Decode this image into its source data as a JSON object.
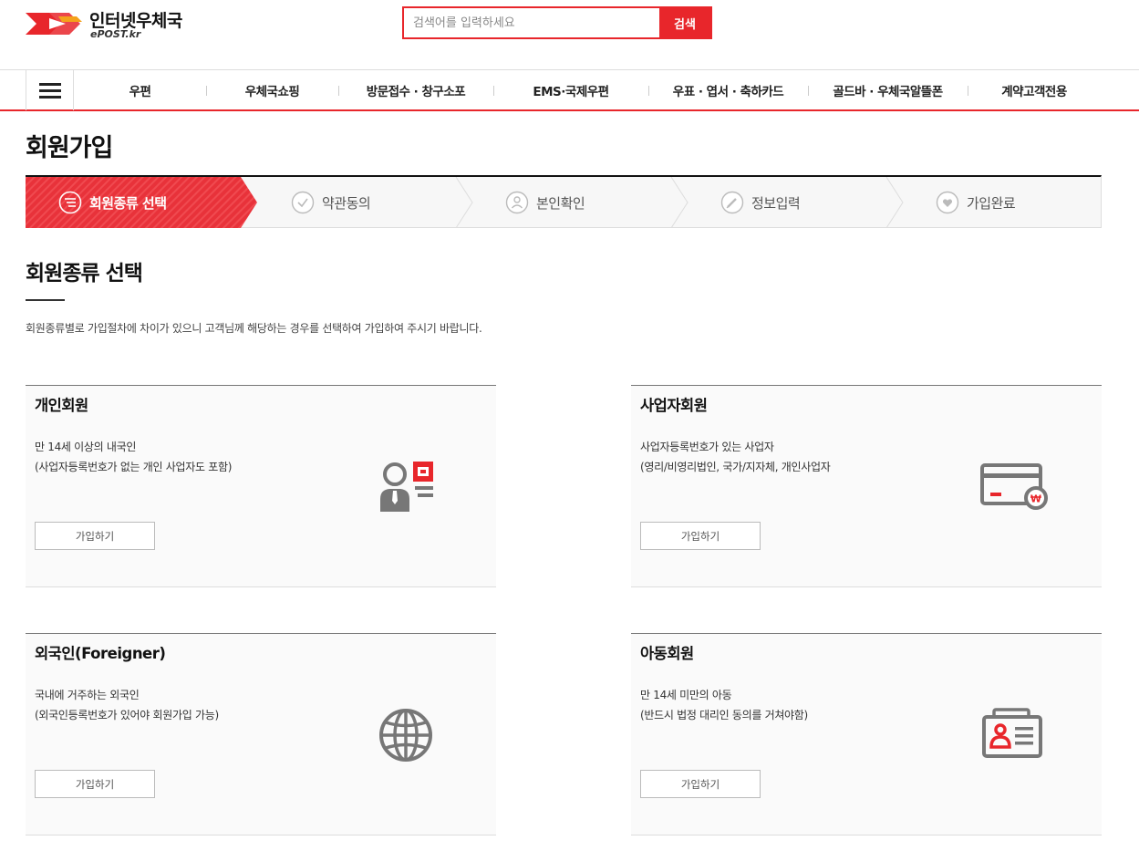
{
  "header": {
    "logo_title": "인터넷우체국",
    "logo_sub": "ePOST.kr",
    "search_placeholder": "검색어를 입력하세요",
    "search_button": "검색"
  },
  "gnb": {
    "items": [
      "우편",
      "우체국쇼핑",
      "방문접수 · 창구소포",
      "EMS·국제우편",
      "우표 · 엽서 · 축하카드",
      "골드바 · 우체국알뜰폰",
      "계약고객전용"
    ]
  },
  "page": {
    "title": "회원가입"
  },
  "steps": [
    {
      "label": "회원종류 선택",
      "icon": "list-icon",
      "active": true
    },
    {
      "label": "약관동의",
      "icon": "check-icon",
      "active": false
    },
    {
      "label": "본인확인",
      "icon": "person-icon",
      "active": false
    },
    {
      "label": "정보입력",
      "icon": "pencil-icon",
      "active": false
    },
    {
      "label": "가입완료",
      "icon": "heart-icon",
      "active": false
    }
  ],
  "section": {
    "title": "회원종류 선택",
    "description": "회원종류별로 가입절차에 차이가 있으니 고객님께 해당하는 경우를 선택하여 가입하여 주시기 바랍니다."
  },
  "cards": [
    {
      "title": "개인회원",
      "line1": "만 14세 이상의 내국인",
      "line2": "(사업자등록번호가 없는 개인 사업자도 포함)",
      "button": "가입하기",
      "icon": "person-card-icon"
    },
    {
      "title": "사업자회원",
      "line1": "사업자등록번호가 있는 사업자",
      "line2": "(영리/비영리법인, 국가/지자체, 개인사업자",
      "button": "가입하기",
      "icon": "credit-card-won-icon"
    },
    {
      "title": "외국인(Foreigner)",
      "line1": "국내에 거주하는 외국인",
      "line2": "(외국인등록번호가 있어야 회원가입 가능)",
      "button": "가입하기",
      "icon": "globe-icon"
    },
    {
      "title": "아동회원",
      "line1": "만 14세 미만의 아동",
      "line2": "(반드시 법정 대리인 동의를 거쳐야함)",
      "button": "가입하기",
      "icon": "id-card-icon"
    }
  ],
  "colors": {
    "accent": "#e8262b",
    "icon_gray": "#777777"
  }
}
